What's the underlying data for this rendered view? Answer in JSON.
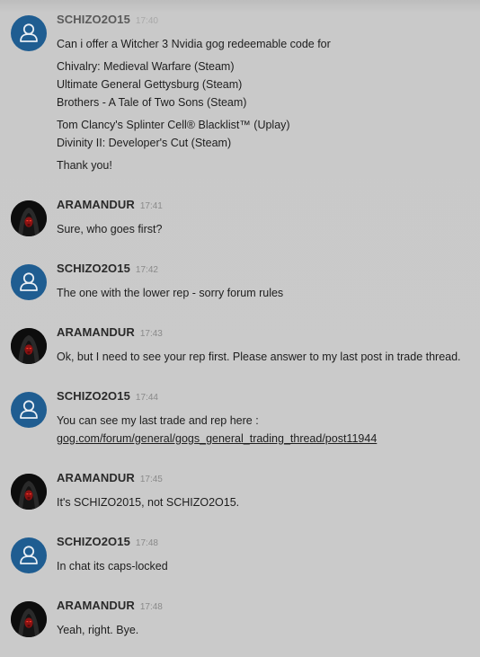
{
  "messages": [
    {
      "author": "SCHIZO2O15",
      "time": "17:40",
      "avatar": "default-user-icon",
      "lines": [
        "Can i offer a Witcher 3 Nvidia gog redeemable code for",
        "Chivalry: Medieval Warfare (Steam)",
        "Ultimate General Gettysburg (Steam)",
        "Brothers - A Tale of Two Sons (Steam)",
        "Tom Clancy's Splinter Cell® Blacklist™ (Uplay)",
        "Divinity II: Developer's Cut (Steam)",
        "Thank you!"
      ]
    },
    {
      "author": "ARAMANDUR",
      "time": "17:41",
      "avatar": "hooded-figure-avatar",
      "lines": [
        "Sure, who goes first?"
      ]
    },
    {
      "author": "SCHIZO2O15",
      "time": "17:42",
      "avatar": "default-user-icon",
      "lines": [
        "The one with the lower rep - sorry forum rules"
      ]
    },
    {
      "author": "ARAMANDUR",
      "time": "17:43",
      "avatar": "hooded-figure-avatar",
      "lines": [
        "Ok, but I need to see your rep first. Please answer to my last post in trade thread."
      ]
    },
    {
      "author": "SCHIZO2O15",
      "time": "17:44",
      "avatar": "default-user-icon",
      "lines": [
        "You can see my last trade and rep here :",
        "gog.com/forum/general/gogs_general_trading_thread/post11944"
      ]
    },
    {
      "author": "ARAMANDUR",
      "time": "17:45",
      "avatar": "hooded-figure-avatar",
      "lines": [
        "It's SCHIZO2015, not SCHIZO2O15."
      ]
    },
    {
      "author": "SCHIZO2O15",
      "time": "17:48",
      "avatar": "default-user-icon",
      "lines": [
        "In chat its caps-locked"
      ]
    },
    {
      "author": "ARAMANDUR",
      "time": "17:48",
      "avatar": "hooded-figure-avatar",
      "lines": [
        "Yeah, right. Bye."
      ]
    }
  ]
}
